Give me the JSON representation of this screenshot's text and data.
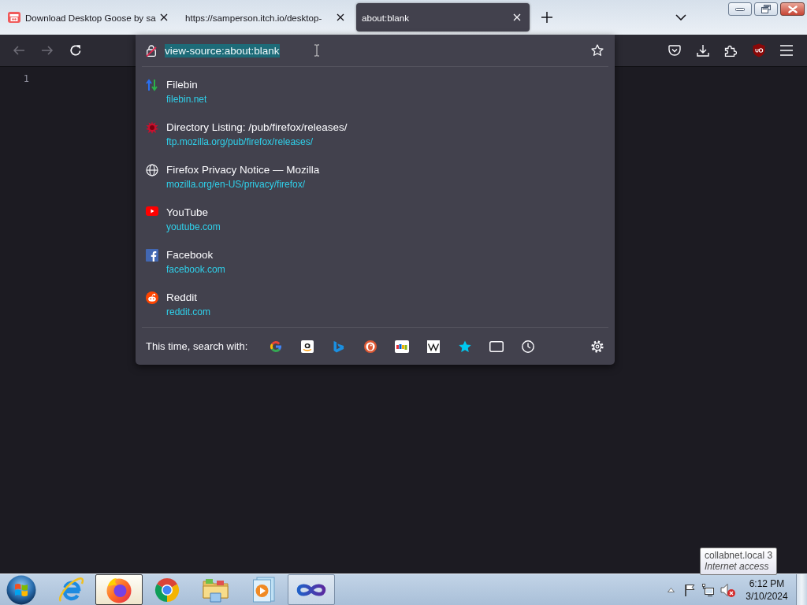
{
  "tabs": [
    {
      "title": "Download Desktop Goose by sa",
      "favicon": true,
      "selected": false
    },
    {
      "title": "https://samperson.itch.io/desktop-",
      "favicon": false,
      "selected": false
    },
    {
      "title": "about:blank",
      "favicon": false,
      "selected": true
    }
  ],
  "toolbar": {
    "back": {
      "disabled": true
    },
    "forward": {
      "disabled": true
    },
    "reload": {
      "disabled": false
    }
  },
  "urlbar": {
    "value": "view-source:about:blank",
    "text_selected": true
  },
  "suggestions": [
    {
      "title": "Filebin",
      "url": "filebin.net"
    },
    {
      "title": "Directory Listing: /pub/firefox/releases/",
      "url": "ftp.mozilla.org/pub/firefox/releases/"
    },
    {
      "title": "Firefox Privacy Notice — Mozilla",
      "url": "mozilla.org/en-US/privacy/firefox/"
    },
    {
      "title": "YouTube",
      "url": "youtube.com"
    },
    {
      "title": "Facebook",
      "url": "facebook.com"
    },
    {
      "title": "Reddit",
      "url": "reddit.com"
    }
  ],
  "search_bar": {
    "label": "This time, search with:"
  },
  "page": {
    "line_numbers": [
      "1"
    ]
  },
  "taskbar": {
    "apps": [
      {
        "running": false,
        "active": false
      },
      {
        "running": true,
        "active": true
      },
      {
        "running": false,
        "active": false
      },
      {
        "running": false,
        "active": false
      },
      {
        "running": false,
        "active": false
      },
      {
        "running": true,
        "active": false
      }
    ]
  },
  "tray": {
    "volume_muted": true,
    "clock": {
      "time": "6:12 PM",
      "date": "3/10/2024"
    }
  },
  "tooltip": {
    "title": "collabnet.local 3",
    "subtitle": "Internet access"
  }
}
